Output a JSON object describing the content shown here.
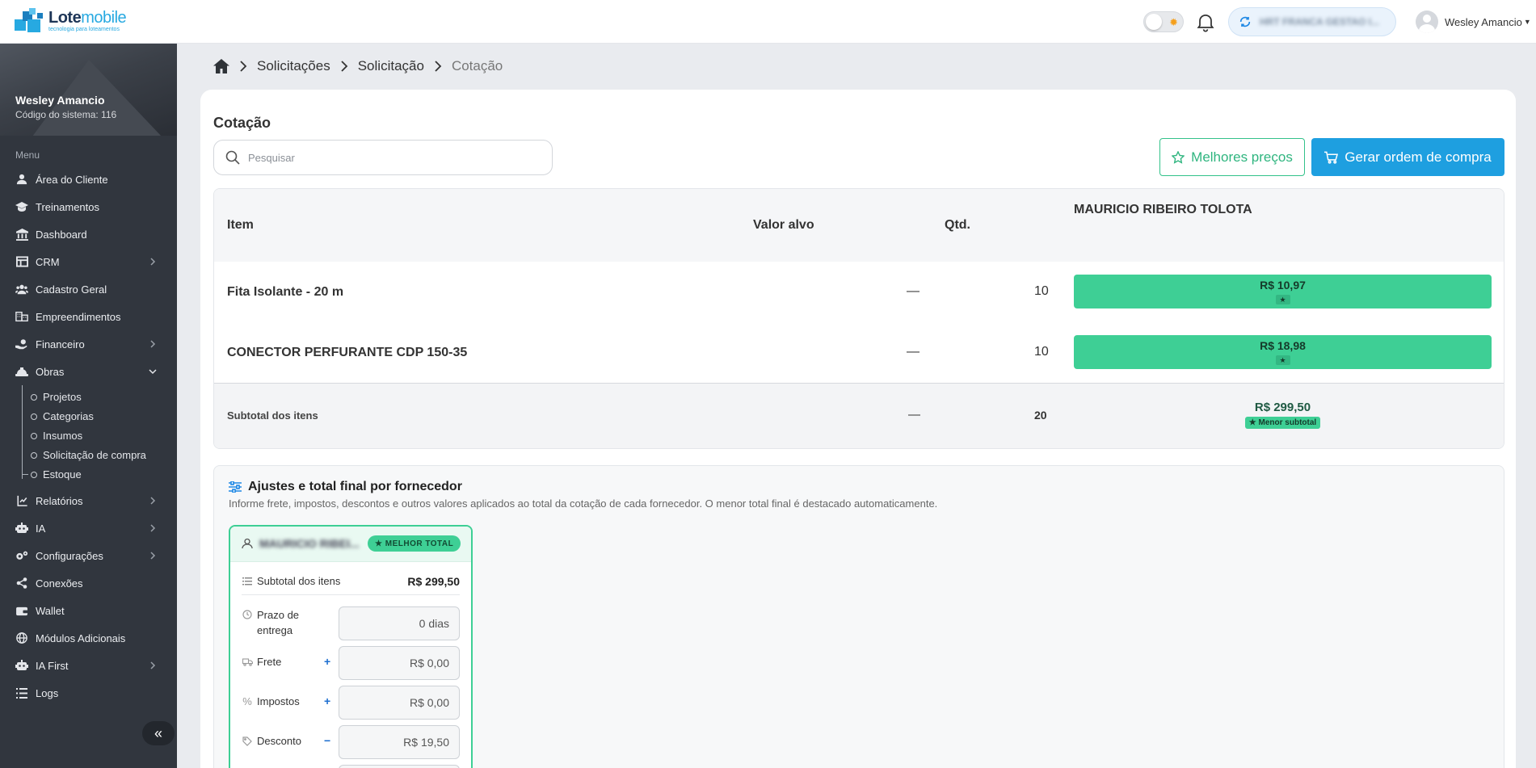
{
  "app": {
    "brand_main": "Lote",
    "brand_accent": "mobile",
    "tagline": "tecnologia para loteamentos",
    "accent_color": "#27a9e1",
    "success_color": "#3ecf95"
  },
  "header": {
    "org_name": "HRT FRANCA GESTAO I...",
    "user_name": "Wesley Amancio"
  },
  "sidebar": {
    "user_name": "Wesley Amancio",
    "system_code": "Código do sistema: 116",
    "menu_label": "Menu",
    "items": [
      {
        "label": "Área do Cliente",
        "icon": "user-icon"
      },
      {
        "label": "Treinamentos",
        "icon": "graduation-cap-icon"
      },
      {
        "label": "Dashboard",
        "icon": "bank-icon"
      },
      {
        "label": "CRM",
        "icon": "board-icon"
      },
      {
        "label": "Cadastro Geral",
        "icon": "users-icon"
      },
      {
        "label": "Empreendimentos",
        "icon": "buildings-icon"
      },
      {
        "label": "Financeiro",
        "icon": "money-hand-icon"
      },
      {
        "label": "Obras",
        "icon": "helmet-icon"
      },
      {
        "label": "Relatórios",
        "icon": "report-icon"
      },
      {
        "label": "IA",
        "icon": "robot-icon"
      },
      {
        "label": "Configurações",
        "icon": "gears-icon"
      },
      {
        "label": "Conexões",
        "icon": "share-icon"
      },
      {
        "label": "Wallet",
        "icon": "wallet-icon"
      },
      {
        "label": "Módulos Adicionais",
        "icon": "globe-icon"
      },
      {
        "label": "IA First",
        "icon": "robot-icon"
      },
      {
        "label": "Logs",
        "icon": "list-icon"
      }
    ],
    "obras_sub": [
      "Projetos",
      "Categorias",
      "Insumos",
      "Solicitação de compra",
      "Estoque"
    ]
  },
  "breadcrumb": {
    "items": [
      "Solicitações",
      "Solicitação"
    ],
    "current": "Cotação"
  },
  "page": {
    "title": "Cotação",
    "search_placeholder": "Pesquisar",
    "best_prices_label": "Melhores preços",
    "generate_order_label": "Gerar ordem de compra"
  },
  "table": {
    "headers": {
      "item": "Item",
      "target": "Valor alvo",
      "qty": "Qtd.",
      "supplier": "MAURICIO RIBEIRO TOLOTA"
    },
    "rows": [
      {
        "item": "Fita Isolante - 20 m",
        "target": "—",
        "qty": "10",
        "price": "R$ 10,97",
        "star": "★"
      },
      {
        "item": "CONECTOR PERFURANTE CDP 150-35",
        "target": "—",
        "qty": "10",
        "price": "R$ 18,98",
        "star": "★"
      }
    ],
    "subtotal": {
      "label": "Subtotal dos itens",
      "target": "—",
      "qty": "20",
      "value": "R$ 299,50",
      "badge": "★ Menor subtotal"
    }
  },
  "adjustments": {
    "title": "Ajustes e total final por fornecedor",
    "description": "Informe frete, impostos, descontos e outros valores aplicados ao total da cotação de cada fornecedor. O menor total final é destacado automaticamente.",
    "supplier": {
      "name": "MAURICIO RIBEI...",
      "badge": "★ MELHOR TOTAL",
      "subtotal_label": "Subtotal dos itens",
      "subtotal_value": "R$ 299,50",
      "delivery_label": "Prazo de entrega",
      "delivery_value": "0 dias",
      "freight_label": "Frete",
      "freight_sign": "+",
      "freight_value": "R$ 0,00",
      "taxes_label": "Impostos",
      "taxes_sign": "+",
      "taxes_value": "R$ 0,00",
      "discount_label": "Desconto",
      "discount_sign": "−",
      "discount_value": "R$ 19,50"
    }
  }
}
